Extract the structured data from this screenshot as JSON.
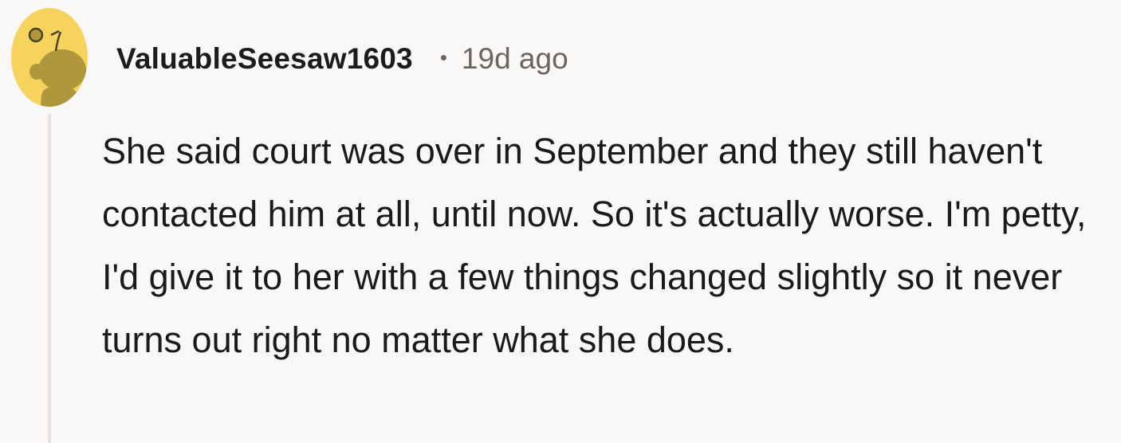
{
  "comment": {
    "username": "ValuableSeesaw1603",
    "separator": "•",
    "timestamp": "19d ago",
    "body": "She said court was over in September and they still haven't contacted him at all, until now. So it's actually worse. I'm petty, I'd give it to her with a few things changed slightly so it never turns out right no matter what she does.",
    "avatar": {
      "icon": "snoo-avatar-icon",
      "background_color": "#f5d35c",
      "figure_color": "#b09a3c"
    },
    "thread_line_color": "#e7e1dc"
  }
}
